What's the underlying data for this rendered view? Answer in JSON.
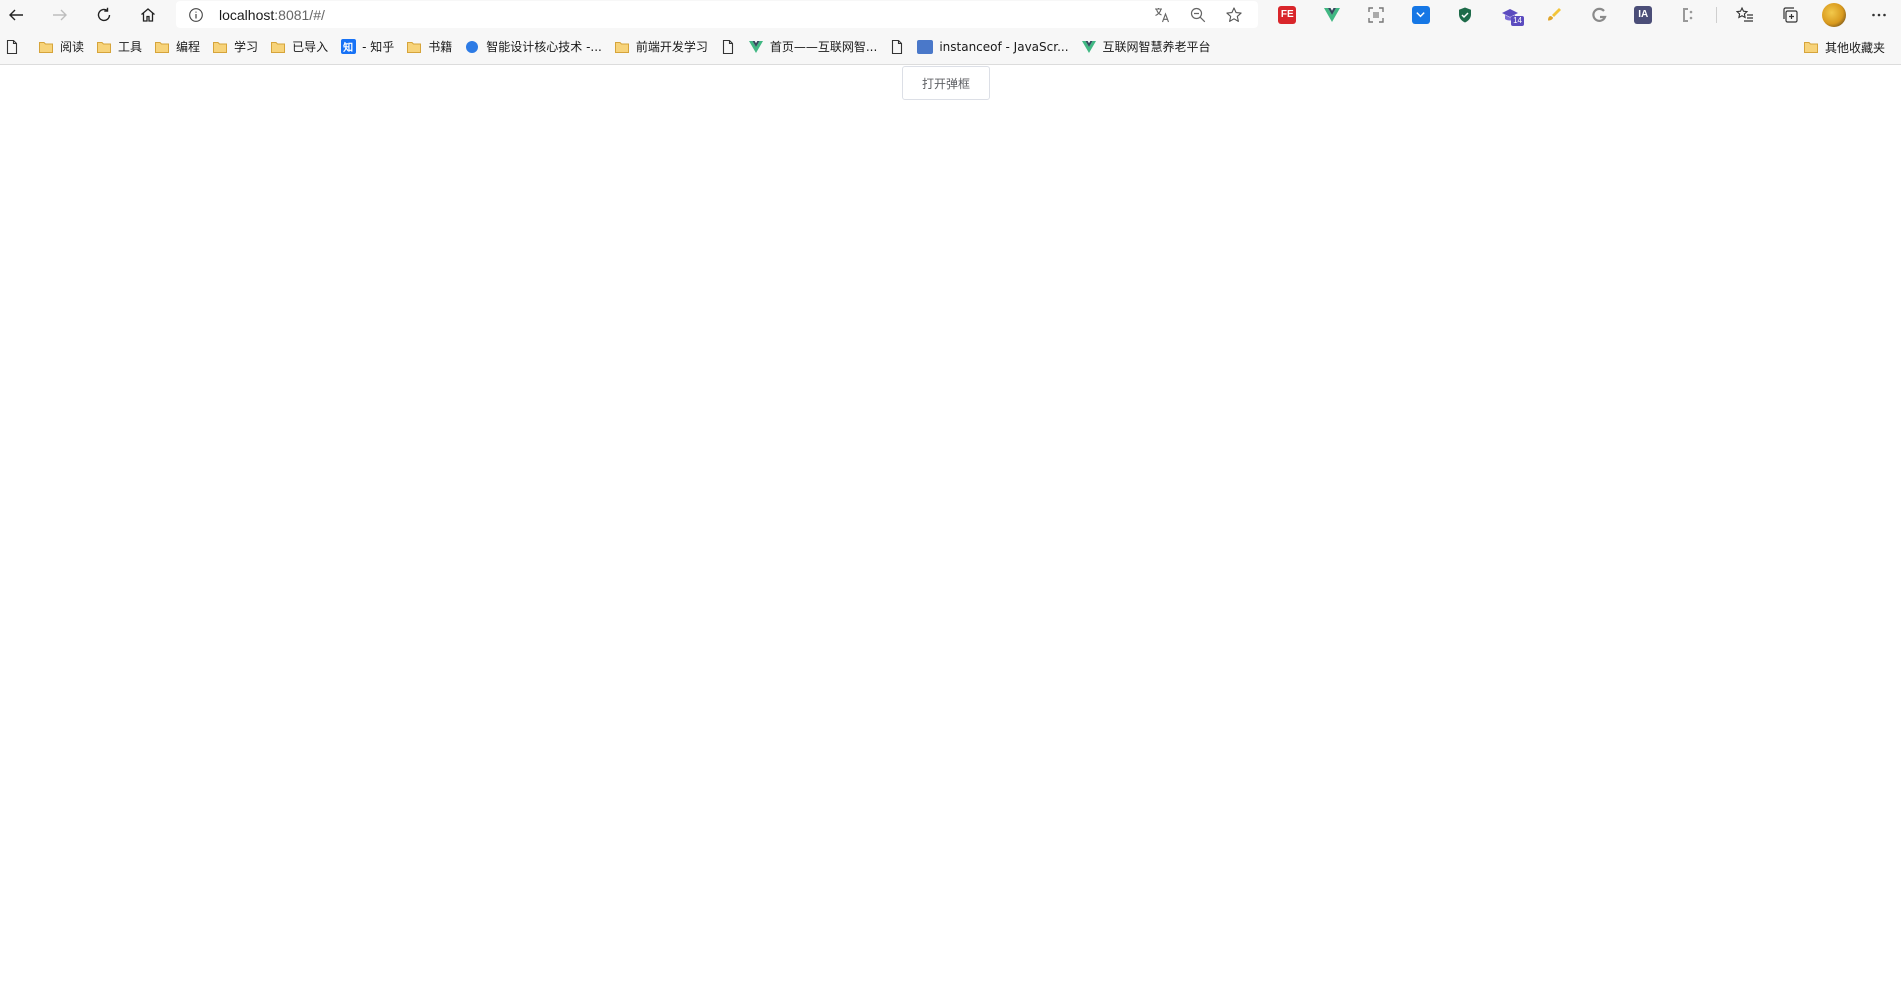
{
  "browser": {
    "url_host": "localhost",
    "url_rest": ":8081/#/"
  },
  "bookmarks": {
    "items": [
      {
        "label": "阅读",
        "icon": "folder-icon"
      },
      {
        "label": "工具",
        "icon": "folder-icon"
      },
      {
        "label": "编程",
        "icon": "folder-icon"
      },
      {
        "label": "学习",
        "icon": "folder-icon"
      },
      {
        "label": "已导入",
        "icon": "folder-icon"
      },
      {
        "label": "- 知乎",
        "icon": "zhihu-icon"
      },
      {
        "label": "书籍",
        "icon": "folder-icon"
      },
      {
        "label": "智能设计核心技术 -...",
        "icon": "site-icon"
      },
      {
        "label": "前端开发学习",
        "icon": "folder-icon"
      },
      {
        "label": "",
        "icon": "page-icon"
      },
      {
        "label": "首页——互联网智...",
        "icon": "vue-icon"
      },
      {
        "label": "",
        "icon": "page-icon"
      },
      {
        "label": "instanceof - JavaScr...",
        "icon": "mdn-icon"
      },
      {
        "label": "互联网智慧养老平台",
        "icon": "vue-icon"
      }
    ],
    "other_label": "其他收藏夹"
  },
  "extensions": {
    "fe_label": "FE",
    "ia_label": "IA",
    "badge_count": "14"
  },
  "colors": {
    "toolbar_bg": "#f7f7f7",
    "folder_yellow": "#e8b84a",
    "vue_green": "#35495e",
    "button_text": "#606266"
  },
  "page": {
    "open_dialog_label": "打开弹框"
  }
}
